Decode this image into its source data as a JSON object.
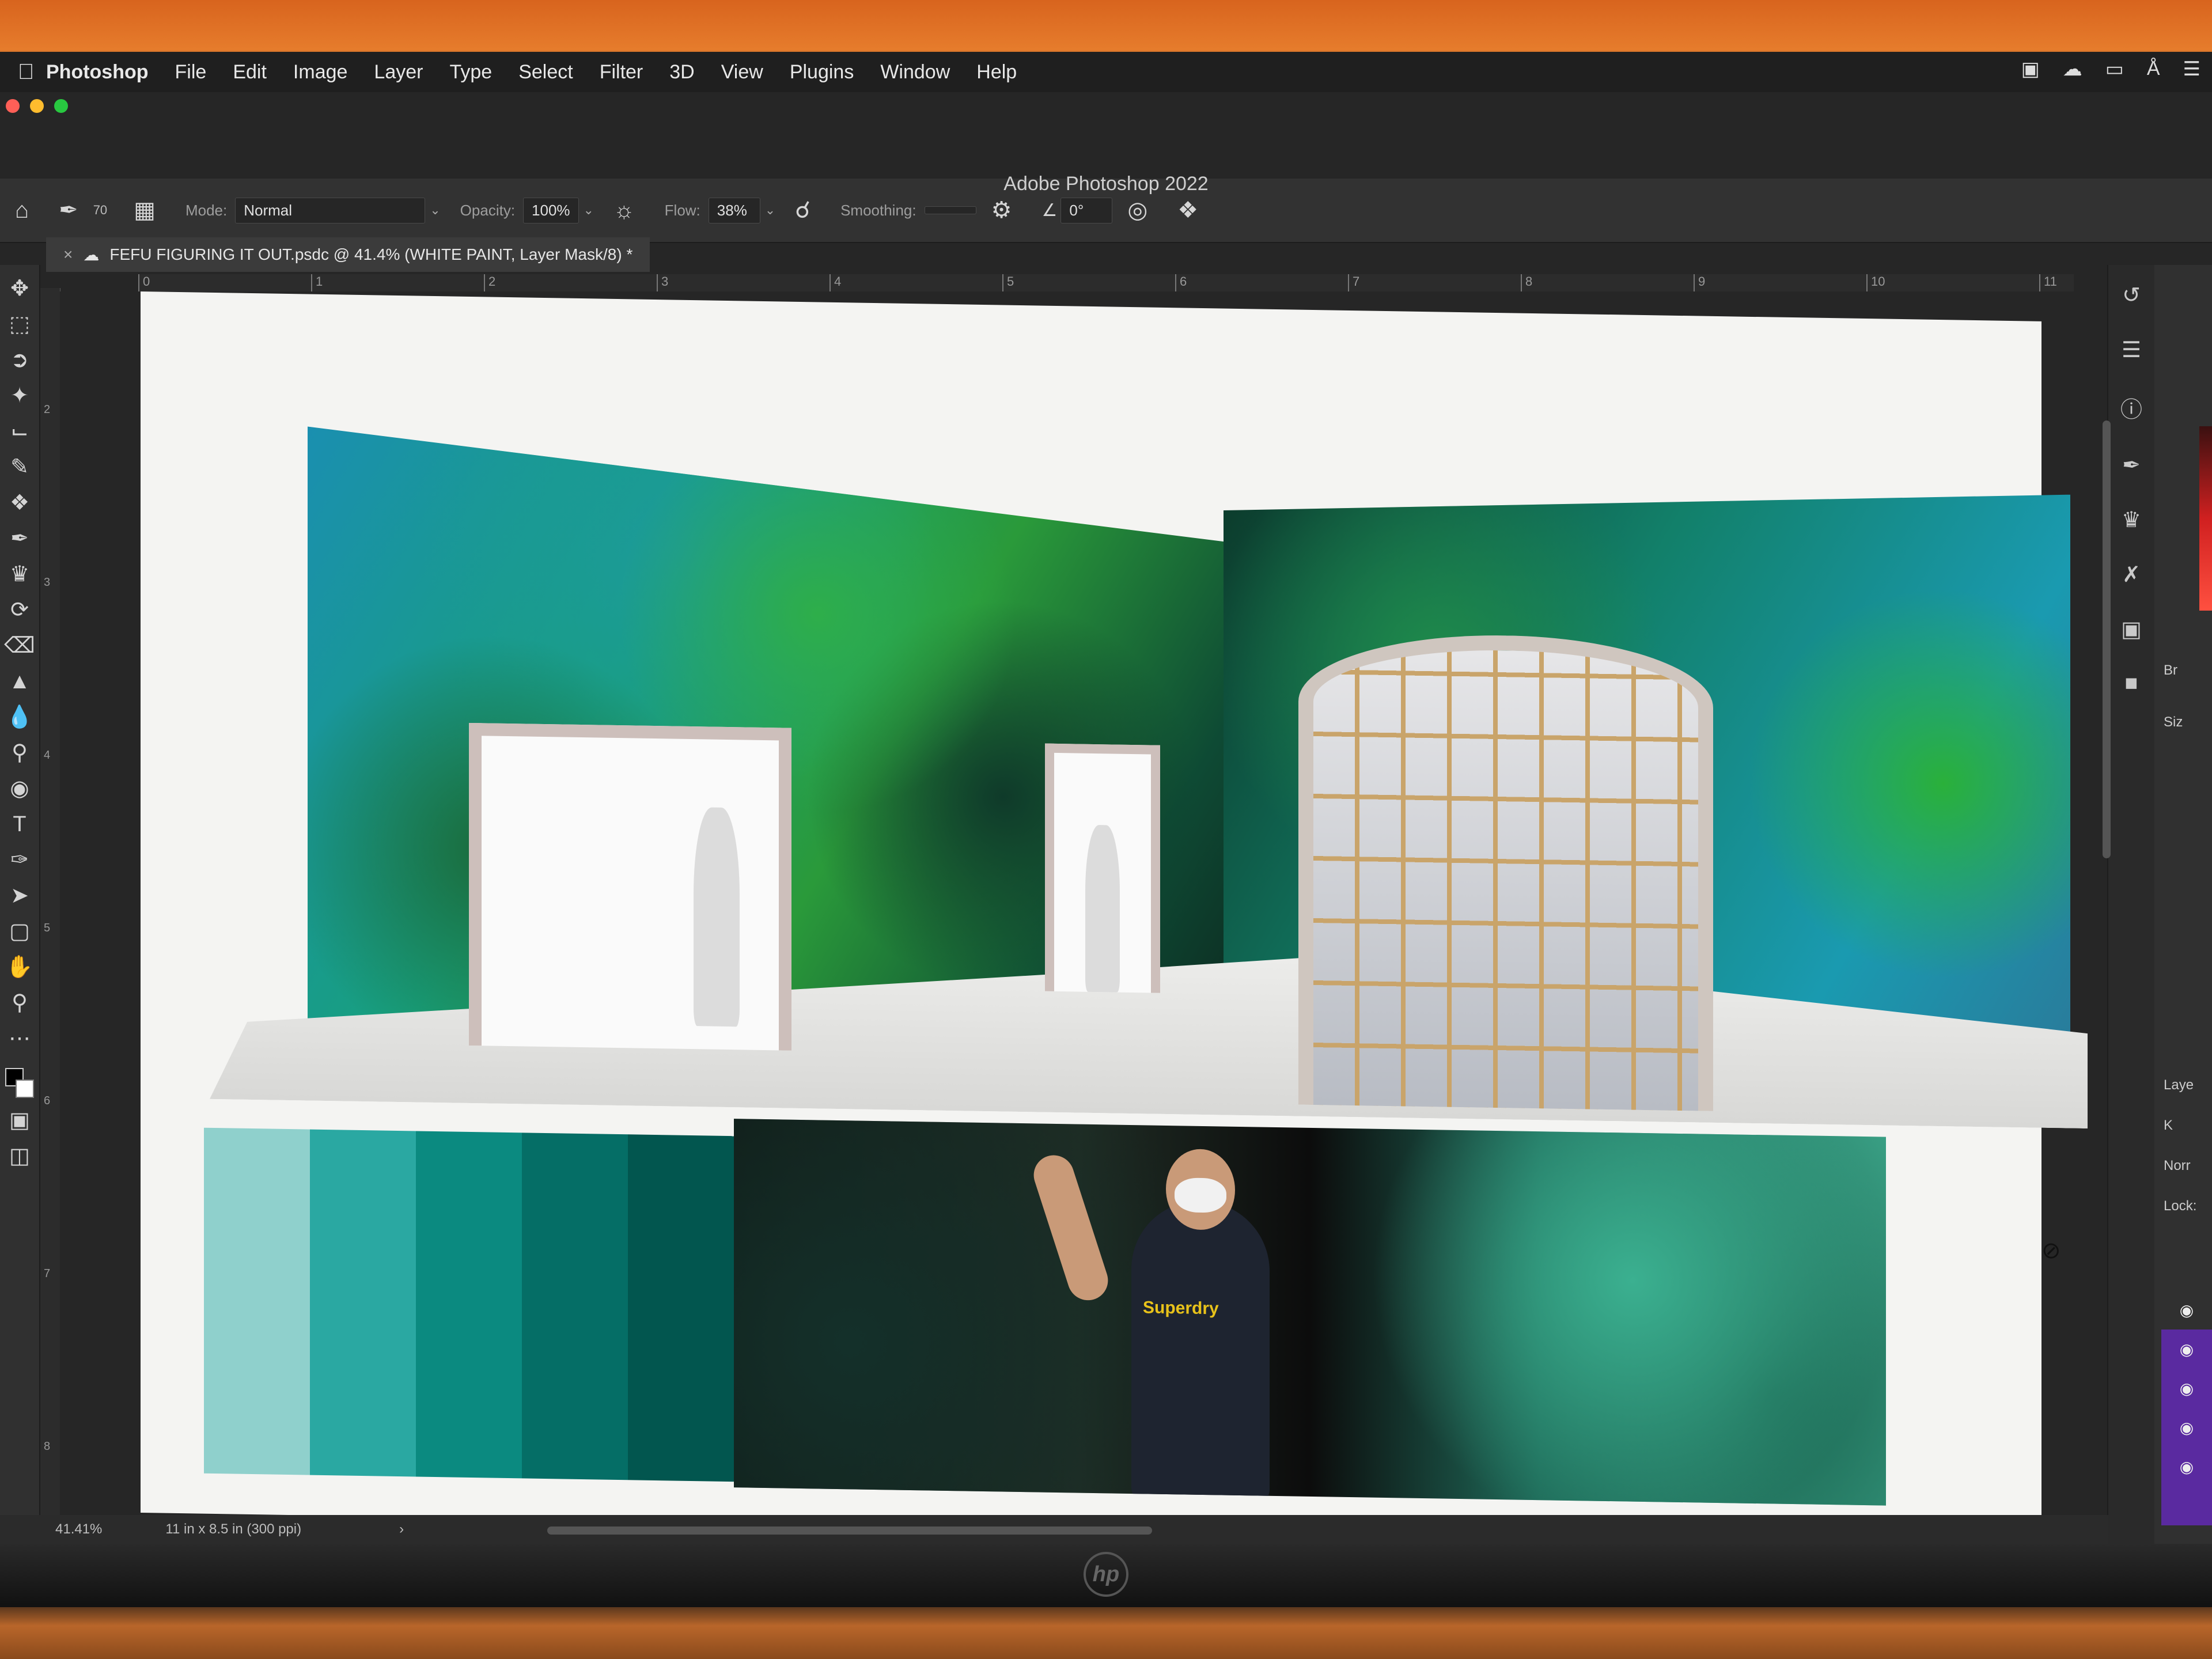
{
  "menubar": {
    "apple_icon": "apple-icon",
    "items": [
      "Photoshop",
      "File",
      "Edit",
      "Image",
      "Layer",
      "Type",
      "Select",
      "Filter",
      "3D",
      "View",
      "Plugins",
      "Window",
      "Help"
    ]
  },
  "window": {
    "title": "Adobe Photoshop 2022",
    "traffic_colors": [
      "#ff5f57",
      "#febc2e",
      "#28c840"
    ]
  },
  "options": {
    "brush_size": "70",
    "mode_label": "Mode:",
    "mode_value": "Normal",
    "opacity_label": "Opacity:",
    "opacity_value": "100%",
    "flow_label": "Flow:",
    "flow_value": "38%",
    "smoothing_label": "Smoothing:",
    "smoothing_value": "",
    "angle_value": "0°"
  },
  "document": {
    "tab_title": "FEFU FIGURING IT OUT.psdc @ 41.4% (WHITE PAINT, Layer Mask/8) *"
  },
  "ruler": {
    "top_ticks": [
      "0",
      "1",
      "2",
      "3",
      "4",
      "5",
      "6",
      "7",
      "8",
      "9",
      "10",
      "11"
    ],
    "left_ticks": [
      "2",
      "3",
      "4",
      "5",
      "6",
      "7",
      "8"
    ]
  },
  "canvas": {
    "palette": [
      "#8fd0cc",
      "#2aa8a2",
      "#0b8a80",
      "#056e66",
      "#02564f"
    ],
    "shirt_text": "Superdry"
  },
  "right_panel": {
    "brush_label": "Br",
    "size_label": "Siz",
    "layers_label": "Laye",
    "search_label": "K",
    "normal_label": "Norr",
    "lock_label": "Lock:"
  },
  "status": {
    "zoom": "41.41%",
    "doc_size": "11 in x 8.5 in (300 ppi)",
    "arrow": "›"
  },
  "brand": {
    "monitor_logo": "hp"
  }
}
